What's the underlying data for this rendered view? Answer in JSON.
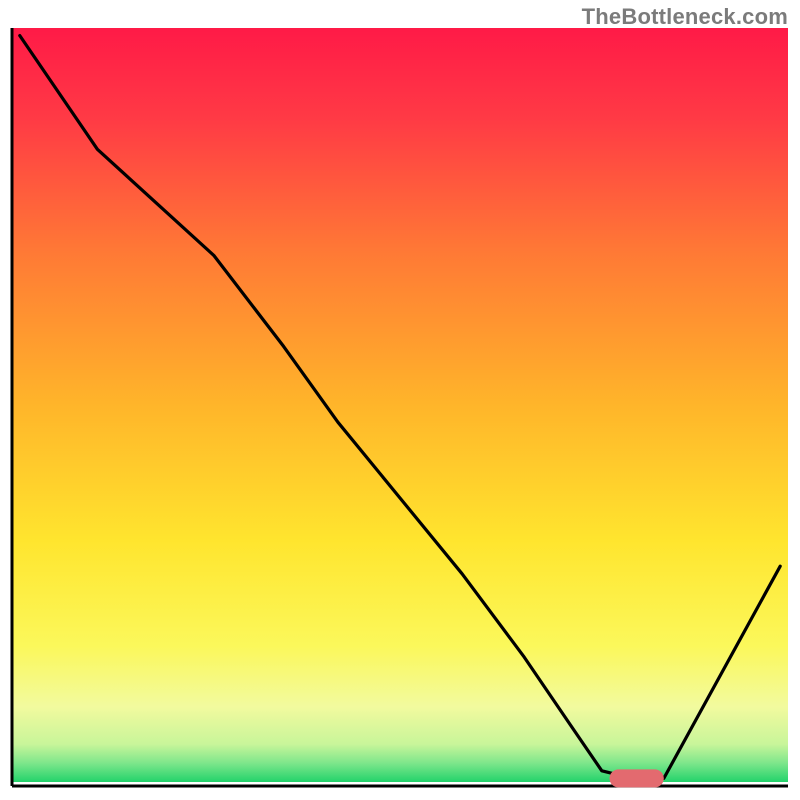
{
  "watermark": "TheBottleneck.com",
  "chart_data": {
    "type": "line",
    "title": "",
    "xlabel": "",
    "ylabel": "",
    "xlim": [
      0,
      100
    ],
    "ylim": [
      0,
      100
    ],
    "background_gradient_top": "#ff1a47",
    "background_gradient_bottom_band": "#23d36b",
    "series": [
      {
        "name": "bottleneck-curve",
        "color": "#000000",
        "x": [
          1,
          11,
          26,
          35,
          42,
          50,
          58,
          66,
          72,
          76,
          80,
          84,
          99
        ],
        "y": [
          99,
          84,
          70,
          58,
          48,
          38,
          28,
          17,
          8,
          2,
          1,
          1,
          29
        ]
      }
    ],
    "optimal_marker": {
      "name": "optimal-range",
      "color": "#e36a6f",
      "x_start": 77,
      "x_end": 84,
      "y": 1
    }
  }
}
